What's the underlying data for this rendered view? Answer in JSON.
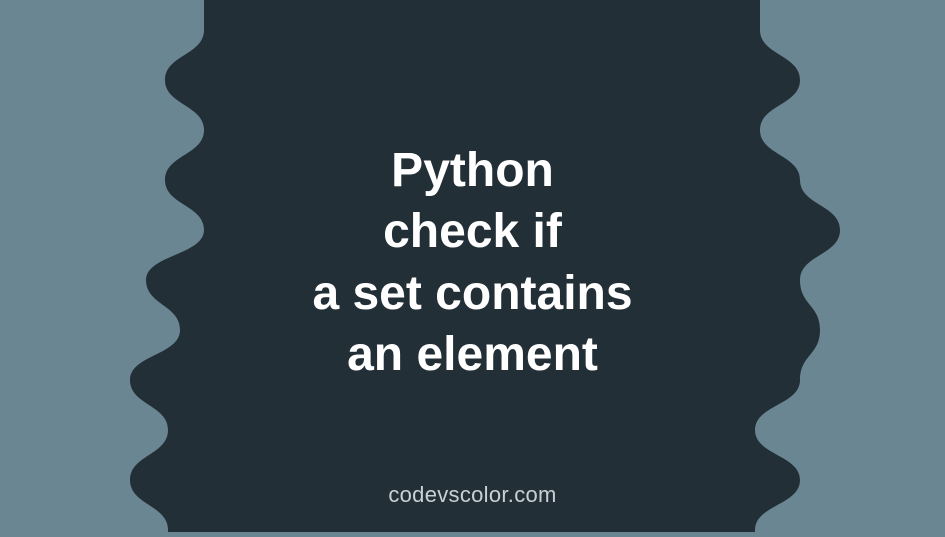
{
  "heading": {
    "line1": "Python",
    "line2": "check if",
    "line3": "a set contains",
    "line4": "an element"
  },
  "watermark": "codevscolor.com",
  "colors": {
    "background": "#6b8693",
    "blob": "#232f36",
    "text": "#ffffff",
    "watermark": "#c7d0d5"
  }
}
